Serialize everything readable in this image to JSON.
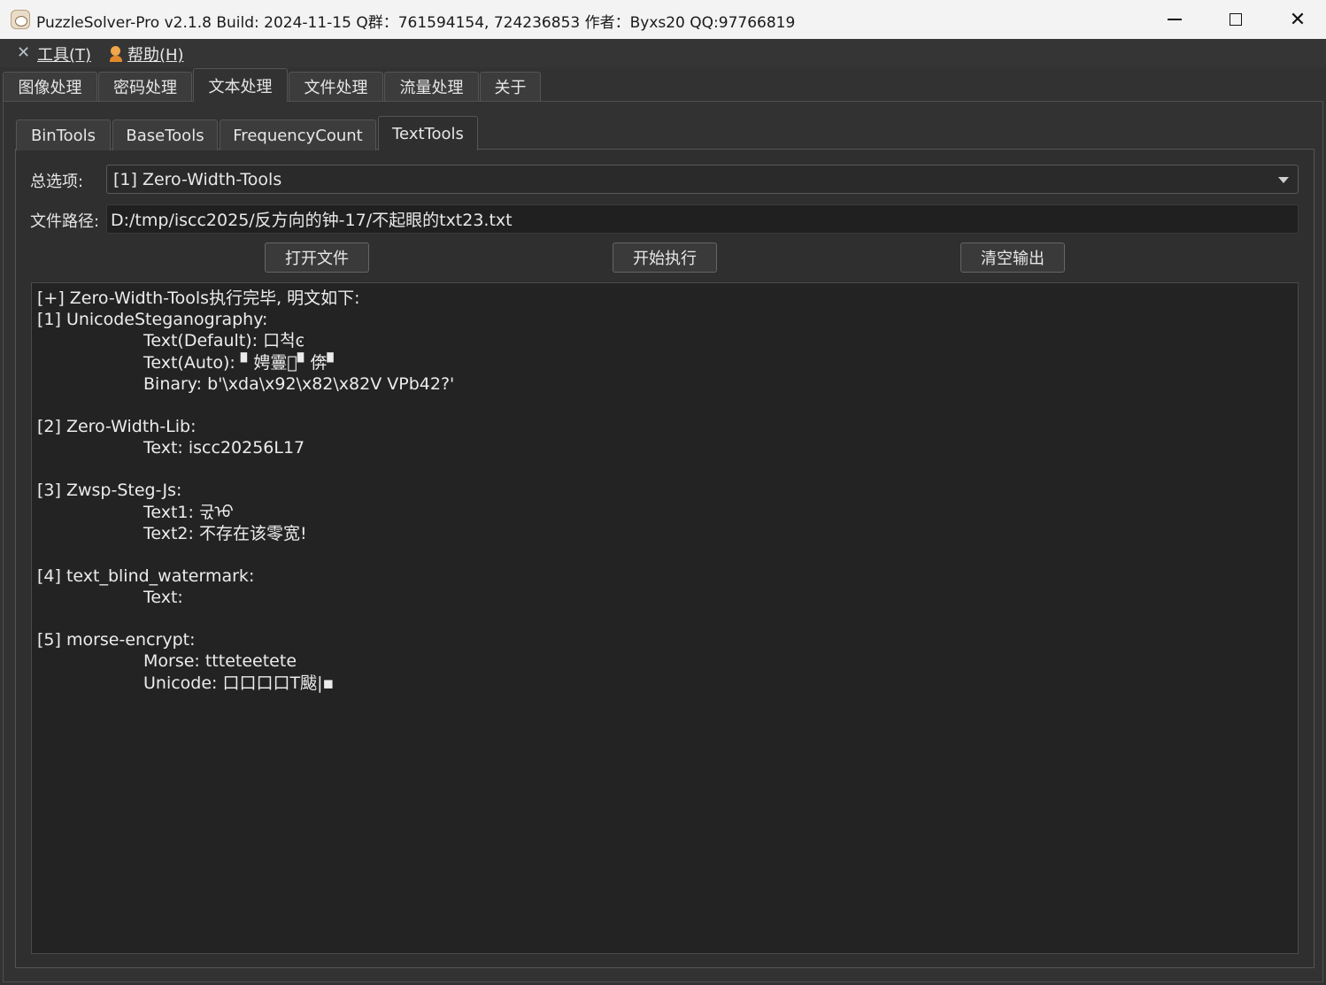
{
  "window": {
    "title": "PuzzleSolver-Pro v2.1.8  Build: 2024-11-15  Q群：761594154, 724236853  作者：Byxs20  QQ:97766819"
  },
  "menubar": {
    "tools": "工具(T)",
    "help": "帮助(H)"
  },
  "main_tabs": [
    "图像处理",
    "密码处理",
    "文本处理",
    "文件处理",
    "流量处理",
    "关于"
  ],
  "sub_tabs": [
    "BinTools",
    "BaseTools",
    "FrequencyCount",
    "TextTools"
  ],
  "form": {
    "option_label": "总选项:",
    "option_value": "[1] Zero-Width-Tools",
    "path_label": "文件路径:",
    "path_value": "D:/tmp/iscc2025/反方向的钟-17/不起眼的txt23.txt"
  },
  "buttons": {
    "open": "打开文件",
    "run": "开始执行",
    "clear": "清空输出"
  },
  "output": {
    "header": "[+] Zero-Width-Tools执行完毕, 明文如下:",
    "s1_title": "[1] UnicodeSteganography:",
    "s1_default": "Text(Default): 口척ͼ",
    "s1_auto": "Text(Auto): ▘娉霻𦊗▘倴▘",
    "s1_binary": "Binary: b'\\xda\\x92\\x82\\x82V VPb42?'",
    "s2_title": "[2] Zero-Width-Lib:",
    "s2_text": "Text: iscc20256L17",
    "s3_title": "[3] Zwsp-Steg-Js:",
    "s3_text1": "Text1: 굯ᡉ",
    "s3_text2": "Text2: 不存在该零宽!",
    "s4_title": "[4] text_blind_watermark:",
    "s4_text": "Text:",
    "s5_title": "[5] morse-encrypt:",
    "s5_morse": "Morse: ttteteetete",
    "s5_unicode": "Unicode: 口口口口T颰|▪"
  }
}
